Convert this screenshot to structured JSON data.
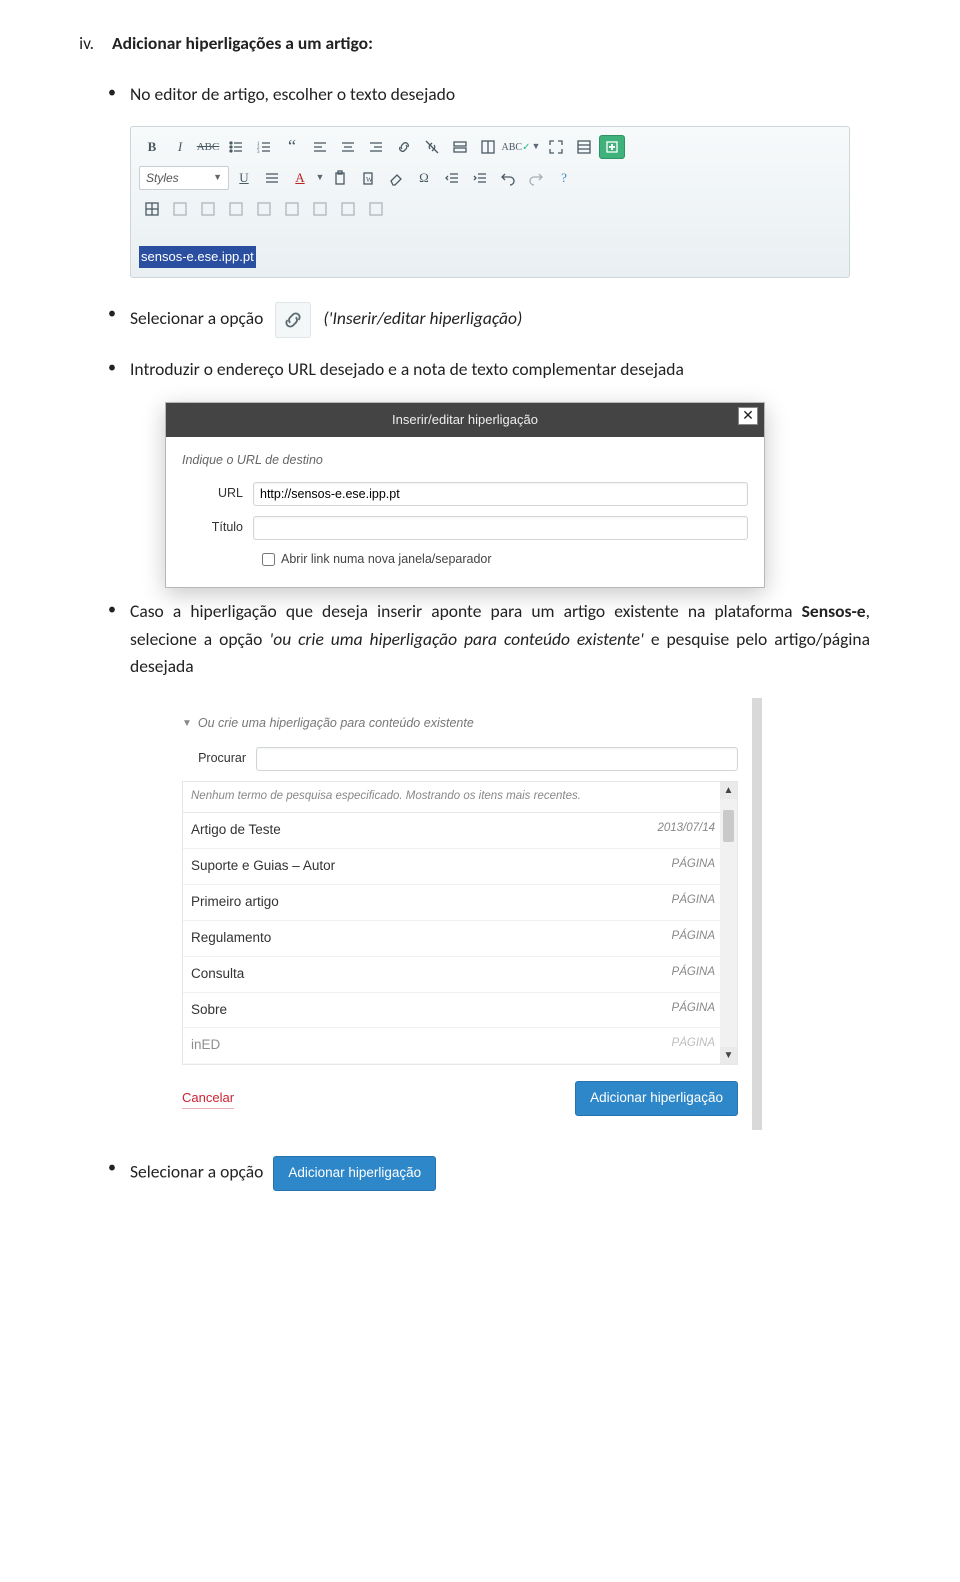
{
  "section": {
    "number": "iv.",
    "title": "Adicionar hiperligações a um artigo:"
  },
  "bullets": {
    "b1": "No editor de artigo, escolher o texto desejado",
    "b2_before": "Selecionar a opção",
    "b2_after": "('Inserir/editar hiperligação)",
    "b3": "Introduzir o endereço URL desejado e a nota de texto complementar desejada",
    "b4_pre": "Caso a hiperligação que deseja inserir aponte para um artigo existente na plataforma ",
    "b4_bold": "Sensos-e",
    "b4_mid": ", selecione a opção ",
    "b4_italic": "'ou crie uma hiperligação para conteúdo existente'",
    "b4_post": " e pesquise pelo artigo/página desejada",
    "b5": "Selecionar a opção"
  },
  "toolbar": {
    "styles_label": "Styles",
    "selected_text": "sensos-e.ese.ipp.pt"
  },
  "dialog1": {
    "title": "Inserir/editar hiperligação",
    "hint": "Indique o URL de destino",
    "url_label": "URL",
    "url_value": "http://sensos-e.ese.ipp.pt",
    "title_label": "Título",
    "title_value": "",
    "checkbox": "Abrir link numa nova janela/separador"
  },
  "dialog2": {
    "header": "Ou crie uma hiperligação para conteúdo existente",
    "search_label": "Procurar",
    "search_value": "",
    "results_hdr": "Nenhum termo de pesquisa especificado. Mostrando os itens mais recentes.",
    "rows": [
      {
        "title": "Artigo de Teste",
        "type": "2013/07/14"
      },
      {
        "title": "Suporte e Guias – Autor",
        "type": "PÁGINA"
      },
      {
        "title": "Primeiro artigo",
        "type": "PÁGINA"
      },
      {
        "title": "Regulamento",
        "type": "PÁGINA"
      },
      {
        "title": "Consulta",
        "type": "PÁGINA"
      },
      {
        "title": "Sobre",
        "type": "PÁGINA"
      },
      {
        "title": "inED",
        "type": "PÁGINA"
      }
    ],
    "cancel": "Cancelar",
    "submit": "Adicionar hiperligação"
  },
  "button_inline": "Adicionar hiperligação"
}
